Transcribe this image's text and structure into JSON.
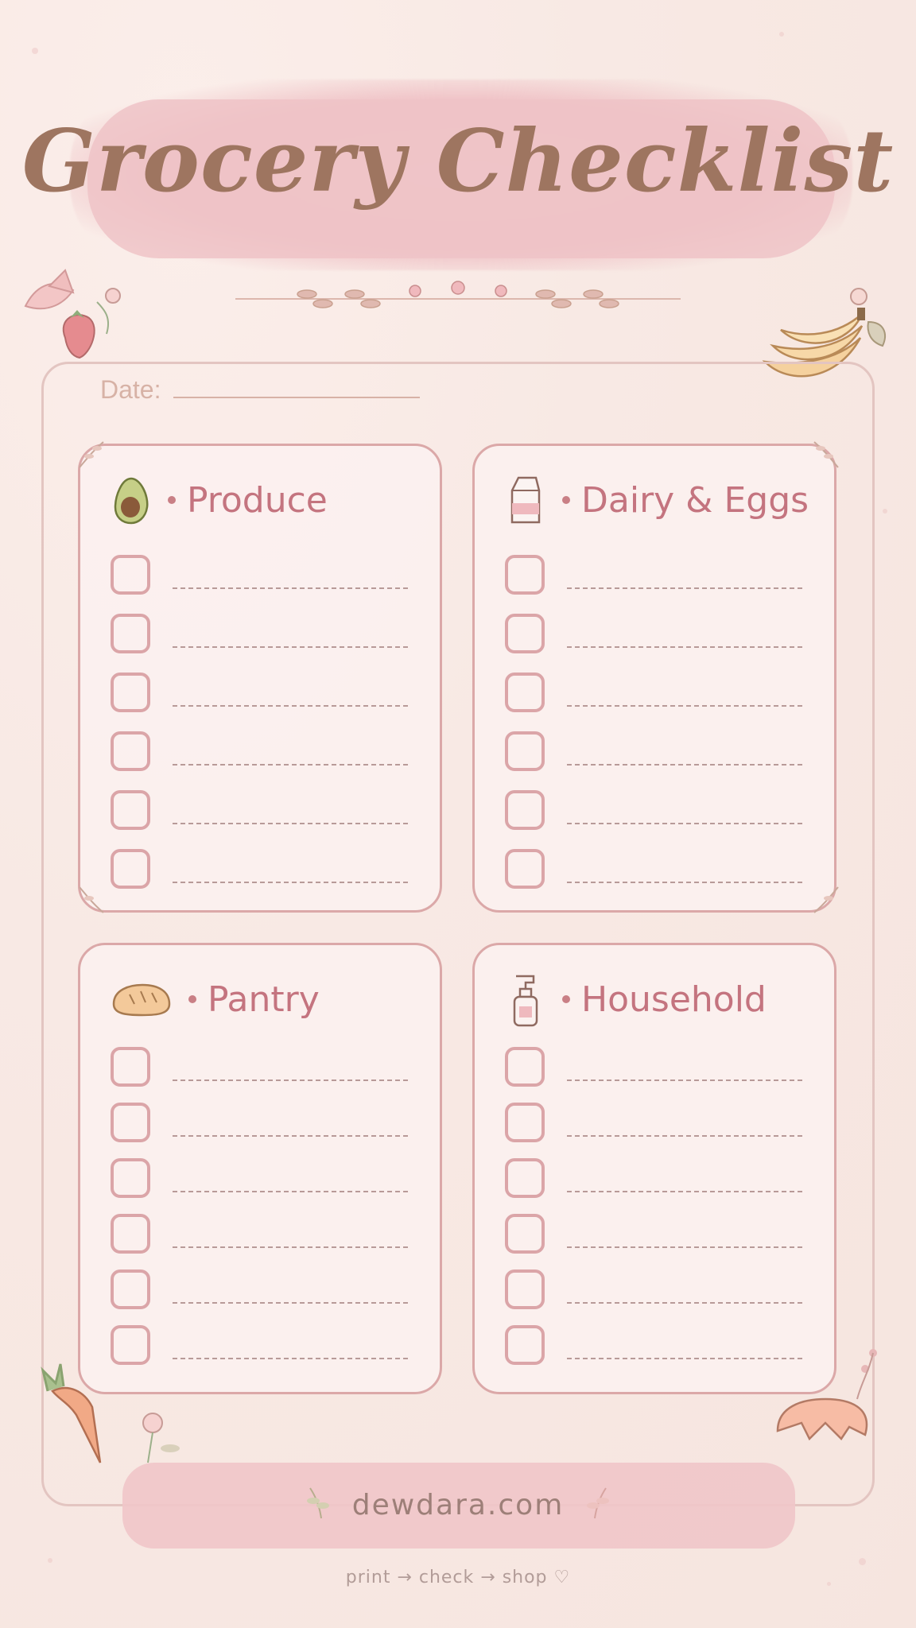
{
  "header": {
    "title": "Grocery Checklist"
  },
  "date": {
    "label": "Date:"
  },
  "sections": [
    {
      "title": "Produce",
      "icon": "avocado-icon",
      "rows": 6
    },
    {
      "title": "Dairy & Eggs",
      "icon": "milk-carton-icon",
      "rows": 6
    },
    {
      "title": "Pantry",
      "icon": "bread-icon",
      "rows": 6
    },
    {
      "title": "Household",
      "icon": "spray-bottle-icon",
      "rows": 6
    }
  ],
  "footer": {
    "site": "dewdara.com",
    "tagline": "print → check → shop ♡"
  },
  "decorations": [
    "leaf-icon",
    "strawberry-icon",
    "flower-icon",
    "banana-icon",
    "carrot-icon",
    "croissant-icon",
    "sprig-icon"
  ],
  "colors": {
    "background": "#f8e9e4",
    "banner": "#efc3c7",
    "title": "#9e7560",
    "section_title": "#c4747f",
    "checkbox": "#dba5a8"
  }
}
